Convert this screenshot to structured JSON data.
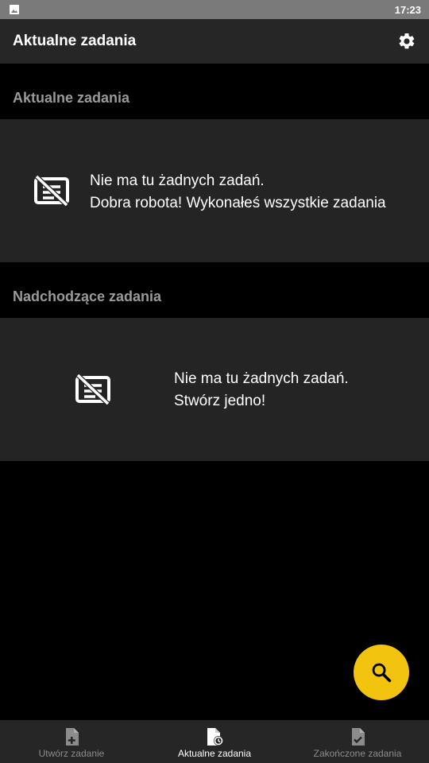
{
  "status_bar": {
    "time": "17:23",
    "notification_icon": "image-icon"
  },
  "app_bar": {
    "title": "Aktualne zadania",
    "settings_icon": "gear-icon"
  },
  "sections": [
    {
      "header": "Aktualne zadania",
      "empty_icon": "no-tasks-icon",
      "message_line1": "Nie ma tu żadnych zadań.",
      "message_line2": "Dobra robota! Wykonałeś wszystkie zadania"
    },
    {
      "header": "Nadchodzące zadania",
      "empty_icon": "no-tasks-icon",
      "message_line1": "Nie ma tu żadnych zadań.",
      "message_line2": "Stwórz jedno!"
    }
  ],
  "fab": {
    "icon": "search-icon",
    "color": "#f2c40f"
  },
  "bottom_nav": [
    {
      "label": "Utwórz zadanie",
      "icon": "document-add-icon",
      "active": false
    },
    {
      "label": "Aktualne zadania",
      "icon": "document-clock-icon",
      "active": true
    },
    {
      "label": "Zakończone zadania",
      "icon": "document-check-icon",
      "active": false
    }
  ]
}
